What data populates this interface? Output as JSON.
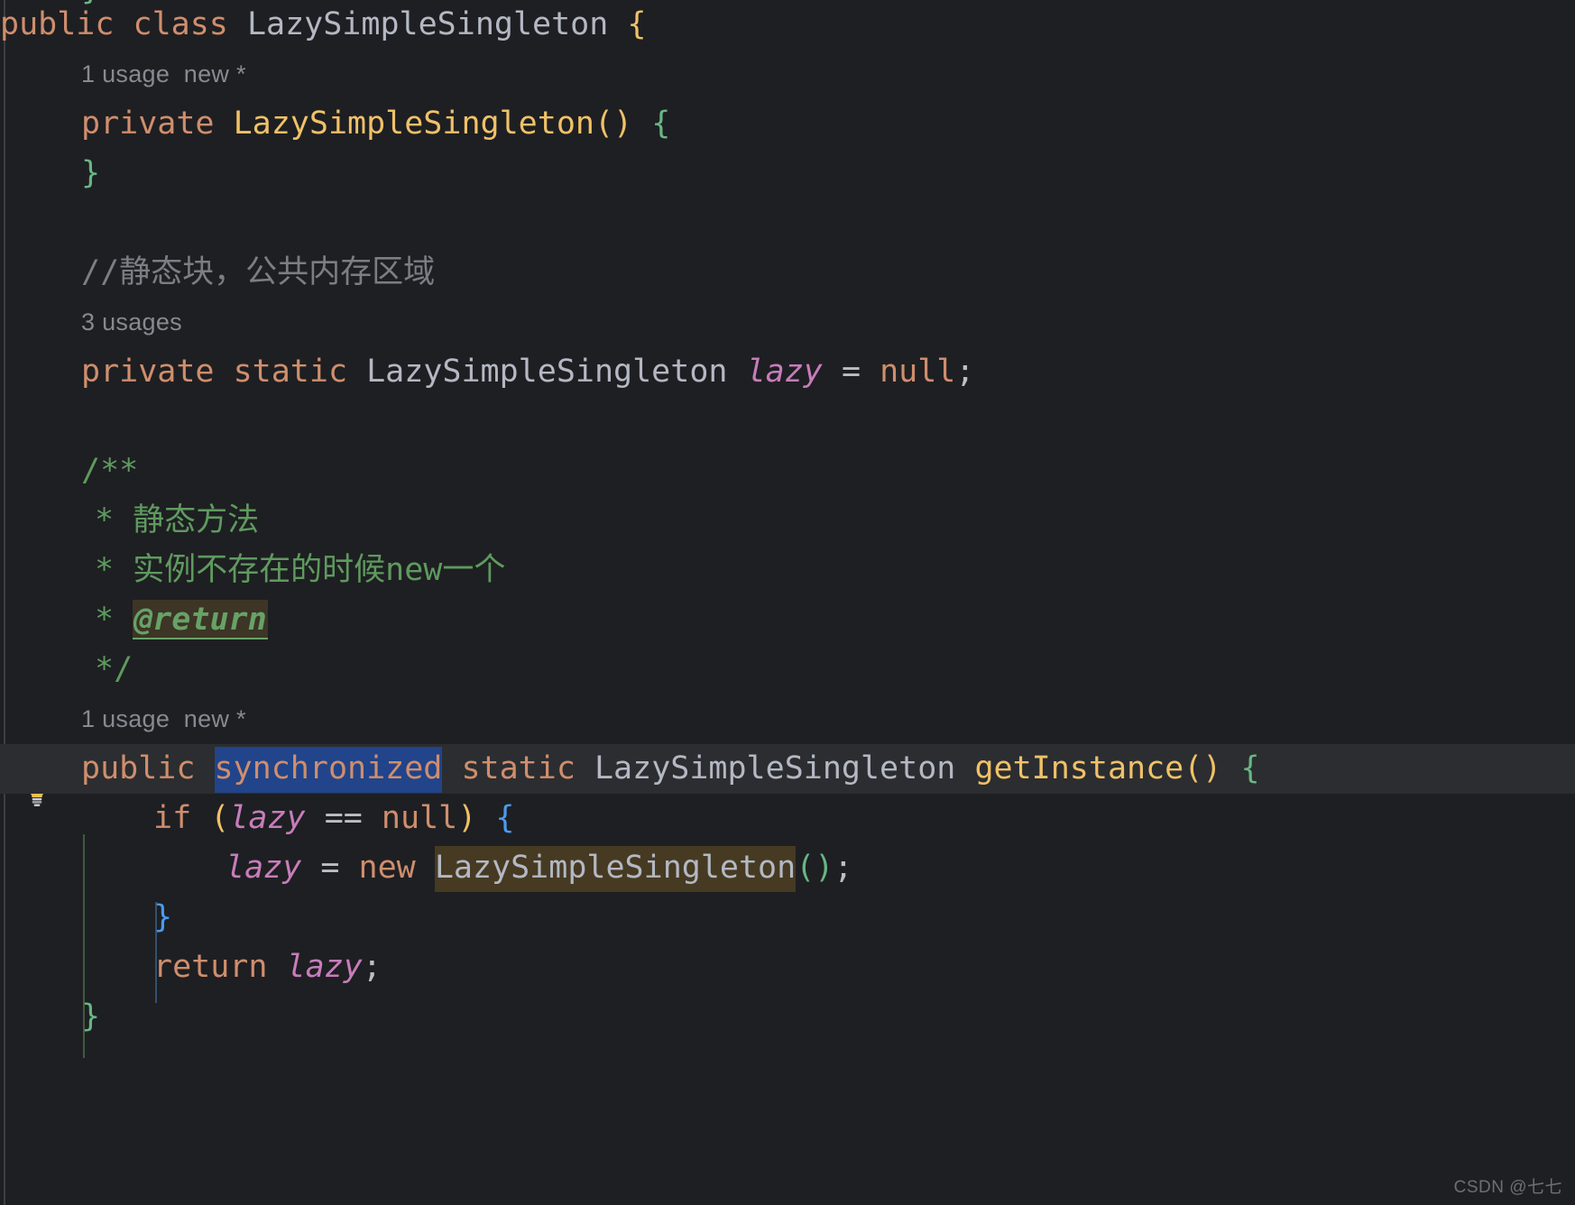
{
  "app": {
    "kind": "ide-code-editor",
    "theme": "dark",
    "language": "Java",
    "background_color": "#1e1f22",
    "caret_line_color": "#2b2d30",
    "selection_color": "#21448a",
    "occurrence_highlight_color": "#463a22"
  },
  "gutter": {
    "bulb_icon": "lightbulb-icon",
    "bulb_color": "#f0c168"
  },
  "code": {
    "lines": [
      {
        "id": "line-class-decl",
        "kind": "code",
        "tokens": [
          {
            "t": "public",
            "c": "kw"
          },
          {
            "t": " ",
            "c": "op"
          },
          {
            "t": "class",
            "c": "kw"
          },
          {
            "t": " ",
            "c": "op"
          },
          {
            "t": "LazySimpleSingleton",
            "c": "type"
          },
          {
            "t": " ",
            "c": "op"
          },
          {
            "t": "{",
            "c": "brace-y"
          }
        ]
      },
      {
        "id": "line-hint-ctor",
        "kind": "hint",
        "indent": 90,
        "text": "1 usage  new *"
      },
      {
        "id": "line-ctor",
        "kind": "code",
        "indent": 90,
        "tokens": [
          {
            "t": "private",
            "c": "kw"
          },
          {
            "t": " ",
            "c": "op"
          },
          {
            "t": "LazySimpleSingleton",
            "c": "method"
          },
          {
            "t": "()",
            "c": "brace-y"
          },
          {
            "t": " ",
            "c": "op"
          },
          {
            "t": "{",
            "c": "brace-g"
          }
        ]
      },
      {
        "id": "line-ctor-close",
        "kind": "code",
        "indent": 90,
        "tokens": [
          {
            "t": "}",
            "c": "brace-g"
          }
        ]
      },
      {
        "id": "line-blank-1",
        "kind": "blank",
        "text": " "
      },
      {
        "id": "line-comment-static-block",
        "kind": "code",
        "indent": 90,
        "tokens": [
          {
            "t": "//静态块，公共内存区域",
            "c": "cmt"
          }
        ]
      },
      {
        "id": "line-hint-field",
        "kind": "hint",
        "indent": 90,
        "text": "3 usages"
      },
      {
        "id": "line-field-lazy",
        "kind": "code",
        "indent": 90,
        "tokens": [
          {
            "t": "private",
            "c": "kw"
          },
          {
            "t": " ",
            "c": "op"
          },
          {
            "t": "static",
            "c": "kw"
          },
          {
            "t": " ",
            "c": "op"
          },
          {
            "t": "LazySimpleSingleton",
            "c": "type"
          },
          {
            "t": " ",
            "c": "op"
          },
          {
            "t": "lazy",
            "c": "field"
          },
          {
            "t": " ",
            "c": "op"
          },
          {
            "t": "=",
            "c": "op"
          },
          {
            "t": " ",
            "c": "op"
          },
          {
            "t": "null",
            "c": "kw"
          },
          {
            "t": ";",
            "c": "op"
          }
        ]
      },
      {
        "id": "line-blank-2",
        "kind": "blank",
        "text": " "
      },
      {
        "id": "line-doc-open",
        "kind": "code",
        "indent": 90,
        "tokens": [
          {
            "t": "/**",
            "c": "doc"
          }
        ]
      },
      {
        "id": "line-doc-1",
        "kind": "code",
        "indent": 105,
        "tokens": [
          {
            "t": "* 静态方法",
            "c": "doc"
          }
        ]
      },
      {
        "id": "line-doc-2",
        "kind": "code",
        "indent": 105,
        "tokens": [
          {
            "t": "* 实例不存在的时候new一个",
            "c": "doc"
          }
        ]
      },
      {
        "id": "line-doc-return",
        "kind": "code",
        "indent": 105,
        "tokens": [
          {
            "t": "* ",
            "c": "doc"
          },
          {
            "t": "@return",
            "c": "doc-tag"
          }
        ]
      },
      {
        "id": "line-doc-close",
        "kind": "code",
        "indent": 105,
        "tokens": [
          {
            "t": "*/",
            "c": "doc"
          }
        ]
      },
      {
        "id": "line-hint-getinstance",
        "kind": "hint",
        "indent": 90,
        "text": "1 usage  new *"
      },
      {
        "id": "line-getinstance-signature",
        "kind": "code",
        "indent": 90,
        "caret": true,
        "tokens": [
          {
            "t": "public",
            "c": "kw"
          },
          {
            "t": " ",
            "c": "op"
          },
          {
            "t": "synchronized",
            "c": "sel"
          },
          {
            "t": " ",
            "c": "op"
          },
          {
            "t": "static",
            "c": "kw"
          },
          {
            "t": " ",
            "c": "op"
          },
          {
            "t": "LazySimpleSingleton",
            "c": "type"
          },
          {
            "t": " ",
            "c": "op"
          },
          {
            "t": "getInstance",
            "c": "method"
          },
          {
            "t": "()",
            "c": "brace-y"
          },
          {
            "t": " ",
            "c": "op"
          },
          {
            "t": "{",
            "c": "brace-g"
          }
        ]
      },
      {
        "id": "line-if-null",
        "kind": "code",
        "indent": 170,
        "tokens": [
          {
            "t": "if",
            "c": "kw"
          },
          {
            "t": " ",
            "c": "op"
          },
          {
            "t": "(",
            "c": "brace-y"
          },
          {
            "t": "lazy",
            "c": "field"
          },
          {
            "t": " ",
            "c": "op"
          },
          {
            "t": "==",
            "c": "op"
          },
          {
            "t": " ",
            "c": "op"
          },
          {
            "t": "null",
            "c": "kw"
          },
          {
            "t": ")",
            "c": "brace-y"
          },
          {
            "t": " ",
            "c": "op"
          },
          {
            "t": "{",
            "c": "brace-b"
          }
        ]
      },
      {
        "id": "line-assign-new",
        "kind": "code",
        "indent": 250,
        "tokens": [
          {
            "t": "lazy",
            "c": "field"
          },
          {
            "t": " ",
            "c": "op"
          },
          {
            "t": "=",
            "c": "op"
          },
          {
            "t": " ",
            "c": "op"
          },
          {
            "t": "new",
            "c": "kw"
          },
          {
            "t": " ",
            "c": "op"
          },
          {
            "t": "LazySimpleSingleton",
            "c": "occ type"
          },
          {
            "t": "()",
            "c": "brace-g"
          },
          {
            "t": ";",
            "c": "op"
          }
        ]
      },
      {
        "id": "line-if-close",
        "kind": "code",
        "indent": 170,
        "tokens": [
          {
            "t": "}",
            "c": "brace-b"
          }
        ]
      },
      {
        "id": "line-return-lazy",
        "kind": "code",
        "indent": 170,
        "tokens": [
          {
            "t": "return",
            "c": "kw"
          },
          {
            "t": " ",
            "c": "op"
          },
          {
            "t": "lazy",
            "c": "field"
          },
          {
            "t": ";",
            "c": "op"
          }
        ]
      },
      {
        "id": "line-method-close",
        "kind": "code",
        "indent": 90,
        "tokens": [
          {
            "t": "}",
            "c": "brace-g"
          }
        ]
      }
    ]
  },
  "watermark": {
    "text": "CSDN @七七"
  }
}
